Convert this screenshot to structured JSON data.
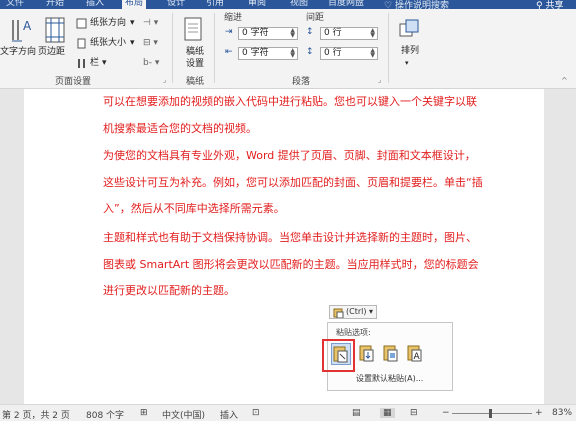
{
  "colors": {
    "ribbon_blue": "#2b579a",
    "doc_text_red": "#e21d1d",
    "highlight_red": "#e23232"
  },
  "tabs": [
    "文件",
    "开始",
    "插入",
    "布局",
    "设计",
    "引用",
    "审阅",
    "视图",
    "百度网盘"
  ],
  "active_tab": "布局",
  "tell_me": "操作说明搜索",
  "share": "共享",
  "ribbon": {
    "page_setup": {
      "text_direction": "文字方向",
      "margins": "页边距",
      "orientation": "纸张方向",
      "size": "纸张大小",
      "columns": "栏",
      "group_label": "页面设置"
    },
    "draft": {
      "button_line1": "稿纸",
      "button_line2": "设置",
      "group_label": "稿纸"
    },
    "paragraph": {
      "indent_header": "缩进",
      "spacing_header": "间距",
      "indent_left": "0 字符",
      "indent_right": "0 字符",
      "spacing_before": "0 行",
      "spacing_after": "0 行",
      "group_label": "段落"
    },
    "arrange": {
      "label": "排列"
    }
  },
  "document": {
    "paragraphs": [
      "可以在想要添加的视频的嵌入代码中进行粘贴。您也可以键入一个关键字以联机搜索最适合您的文档的视频。",
      "为使您的文档具有专业外观，Word 提供了页眉、页脚、封面和文本框设计，这些设计可互为补充。例如，您可以添加匹配的封面、页眉和提要栏。单击“插入”，然后从不同库中选择所需元素。",
      "主题和样式也有助于文档保持协调。当您单击设计并选择新的主题时，图片、图表或 SmartArt 图形将会更改以匹配新的主题。当应用样式时，您的标题会进行更改以匹配新的主题。"
    ],
    "paste_button": "(Ctrl) ▾",
    "paste_options_title": "粘贴选项:",
    "paste_default": "设置默认粘贴(A)..."
  },
  "status": {
    "page": "第 2 页，共 2 页",
    "words": "808 个字",
    "language": "中文(中国)",
    "mode": "插入",
    "zoom": "83%",
    "zoom_minus": "−",
    "zoom_plus": "+"
  }
}
